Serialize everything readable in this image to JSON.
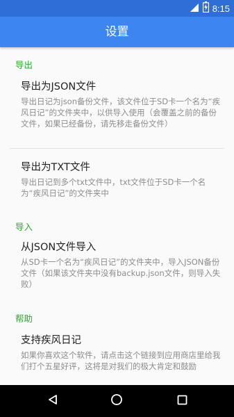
{
  "status_bar": {
    "time": "8:15",
    "icons": [
      "wifi-signal-icon",
      "battery-charging-icon"
    ]
  },
  "app_bar": {
    "title": "设置"
  },
  "sections": {
    "export": {
      "header": "导出",
      "items": [
        {
          "title": "导出为JSON文件",
          "summary": "导出日记为json备份文件，该文件位于SD卡一个名为“疾风日记”的文件夹中，以供导入使用（会覆盖之前的备份文件，如果已经备份，请先移走备份文件）"
        },
        {
          "title": "导出为TXT文件",
          "summary": "导出日记到多个txt文件中，txt文件位于SD卡一个名为“疾风日记”的文件夹中"
        }
      ]
    },
    "import": {
      "header": "导入",
      "items": [
        {
          "title": "从JSON文件导入",
          "summary": "从SD卡一个名为“疾风日记”的文件夹中，导入JSON备份文件（如果该文件夹中没有backup.json文件，则导入失败）"
        }
      ]
    },
    "help": {
      "header": "帮助",
      "items": [
        {
          "title": "支持疾风日记",
          "summary": "如果你喜欢这个软件，请点击这个链接到应用商店里给我们打个五星好评，这将是对我们的极大肯定和鼓励"
        }
      ]
    }
  },
  "nav_bar": {
    "buttons": [
      "back-icon",
      "home-icon",
      "recents-icon"
    ]
  }
}
